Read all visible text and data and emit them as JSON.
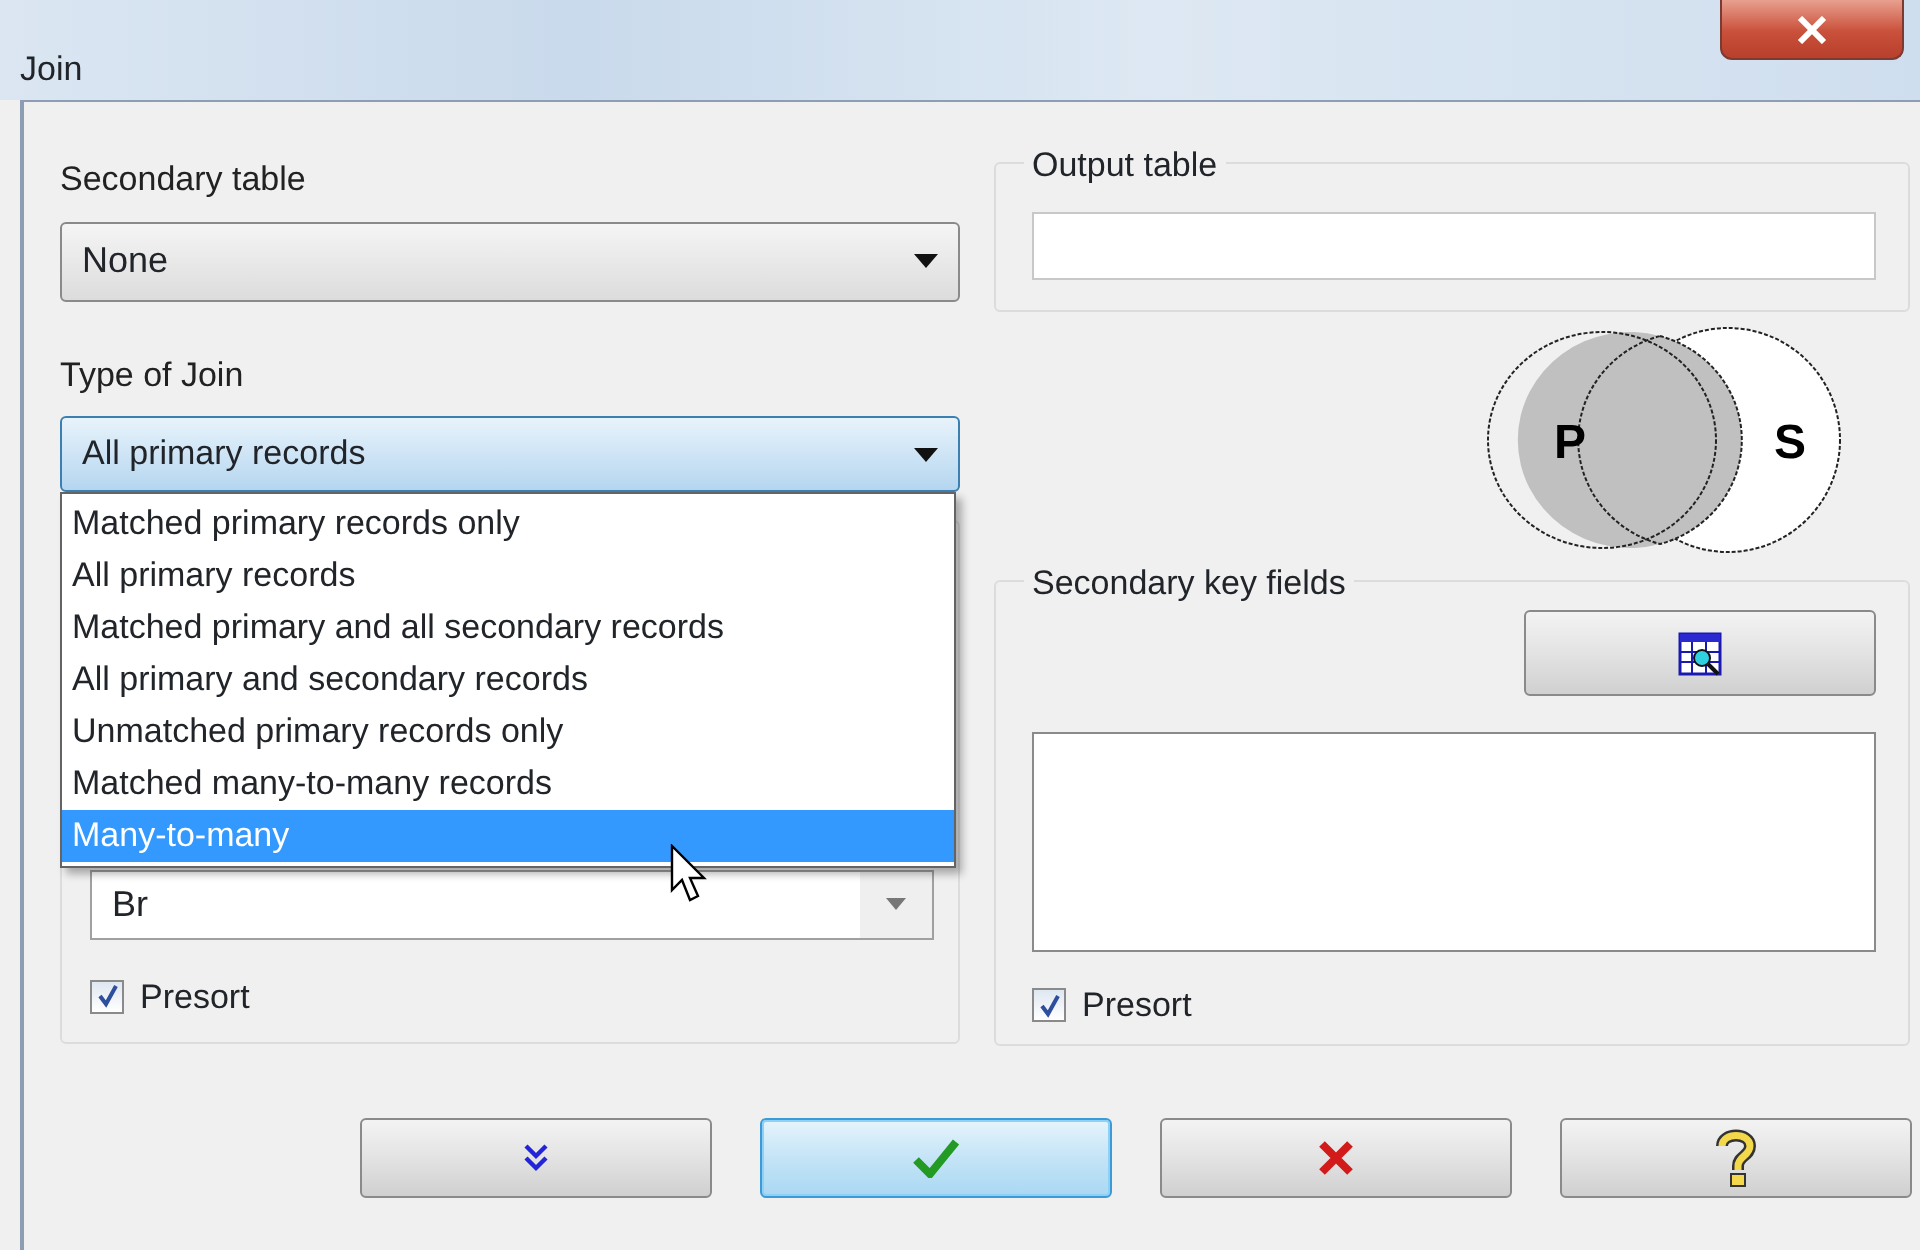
{
  "window": {
    "title": "Join"
  },
  "secondary_table": {
    "label": "Secondary table",
    "value": "None"
  },
  "output_table": {
    "label": "Output table"
  },
  "type_of_join": {
    "label": "Type of Join",
    "value": "All primary records",
    "expanded": true,
    "options": [
      {
        "label": "Matched primary records only",
        "highlighted": false
      },
      {
        "label": "All primary records",
        "highlighted": false
      },
      {
        "label": "Matched primary and all secondary records",
        "highlighted": false
      },
      {
        "label": "All primary and secondary records",
        "highlighted": false
      },
      {
        "label": "Unmatched primary records only",
        "highlighted": false
      },
      {
        "label": "Matched many-to-many records",
        "highlighted": false
      },
      {
        "label": "Many-to-many",
        "highlighted": true
      }
    ]
  },
  "primary_key": {
    "value": "Br",
    "presort": {
      "label": "Presort",
      "checked": true
    }
  },
  "venn": {
    "left": "P",
    "right": "S"
  },
  "secondary_key_fields": {
    "label": "Secondary key fields",
    "presort": {
      "label": "Presort",
      "checked": true
    }
  },
  "buttons": [
    {
      "kind": "more",
      "default": false
    },
    {
      "kind": "ok",
      "default": true
    },
    {
      "kind": "cancel",
      "default": false
    },
    {
      "kind": "help",
      "default": false
    }
  ]
}
